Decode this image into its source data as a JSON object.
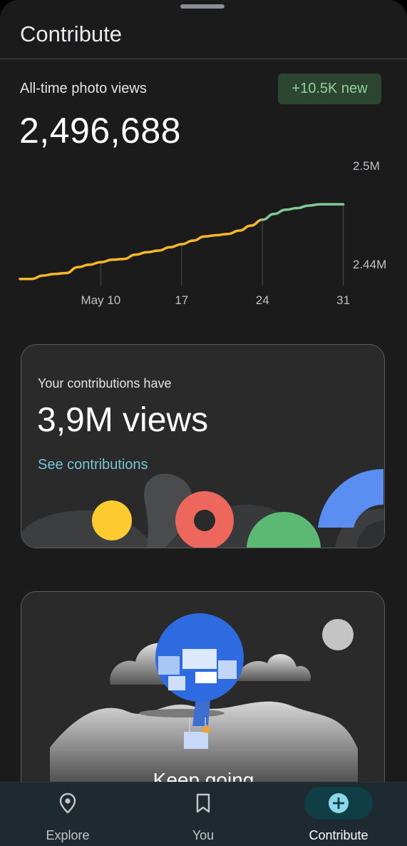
{
  "header": {
    "title": "Contribute"
  },
  "stats": {
    "label": "All-time photo views",
    "total": "2,496,688",
    "new_badge": "+10.5K new"
  },
  "chart_data": {
    "type": "line",
    "x_tick_labels": [
      "May 10",
      "17",
      "24",
      "31"
    ],
    "y_tick_labels": [
      "2.5M",
      "2.44M"
    ],
    "ylim": [
      2440000,
      2500000
    ],
    "series": [
      {
        "color_old": "#f6b72b",
        "color_new": "#81c995",
        "x_days": [
          3,
          4,
          5,
          6,
          7,
          8,
          9,
          10,
          11,
          12,
          13,
          14,
          15,
          16,
          17,
          18,
          19,
          20,
          21,
          22,
          23,
          24,
          25,
          26,
          27,
          28,
          29,
          30,
          31
        ],
        "values": [
          2432000,
          2432000,
          2434000,
          2435000,
          2435500,
          2439000,
          2440500,
          2442000,
          2443500,
          2444000,
          2446500,
          2448000,
          2449000,
          2451000,
          2452800,
          2455000,
          2457500,
          2458200,
          2459000,
          2461000,
          2464000,
          2467500,
          2471000,
          2473500,
          2474500,
          2476000,
          2476800,
          2476800,
          2476800
        ]
      }
    ],
    "new_segment_start_day": 24
  },
  "contrib_card": {
    "subtitle": "Your contributions have",
    "views": "3,9M views",
    "link": "See contributions"
  },
  "progress_card": {
    "title": "Keep going"
  },
  "nav": {
    "items": [
      {
        "label": "Explore",
        "icon": "location-pin-icon"
      },
      {
        "label": "You",
        "icon": "bookmark-icon"
      },
      {
        "label": "Contribute",
        "icon": "add-circle-icon"
      }
    ],
    "active_index": 2
  },
  "colors": {
    "accent_yellow": "#f6b72b",
    "accent_green": "#81c995",
    "link": "#78c3d6",
    "badge_bg": "#2b4530"
  }
}
